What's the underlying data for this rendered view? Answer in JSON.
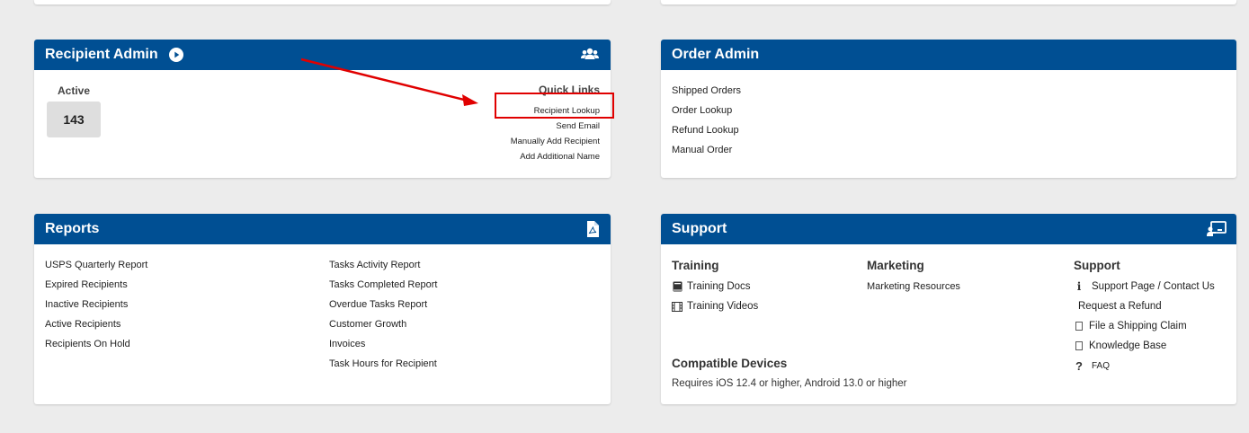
{
  "recipient_admin": {
    "title": "Recipient Admin",
    "active_label": "Active",
    "active_count": "143",
    "quick_links_title": "Quick Links",
    "quick_links": [
      "Recipient Lookup",
      "Send Email",
      "Manually Add Recipient",
      "Add Additional Name"
    ]
  },
  "order_admin": {
    "title": "Order Admin",
    "links": [
      "Shipped Orders",
      "Order Lookup",
      "Refund Lookup",
      "Manual Order"
    ]
  },
  "reports": {
    "title": "Reports",
    "left_links": [
      "USPS Quarterly Report",
      "Expired Recipients",
      "Inactive Recipients",
      "Active Recipients",
      "Recipients On Hold"
    ],
    "right_links": [
      "Tasks Activity Report",
      "Tasks Completed Report",
      "Overdue Tasks Report",
      "Customer Growth",
      "Invoices",
      "Task Hours for Recipient"
    ]
  },
  "support_card": {
    "title": "Support",
    "training": {
      "title": "Training",
      "links": [
        "Training Docs",
        "Training Videos"
      ]
    },
    "marketing": {
      "title": "Marketing",
      "links": [
        "Marketing Resources"
      ]
    },
    "support": {
      "title": "Support",
      "links": [
        "Support Page / Contact Us",
        "Request a Refund",
        "File a Shipping Claim",
        "Knowledge Base",
        "FAQ"
      ]
    },
    "compatible": {
      "title": "Compatible Devices",
      "text": "Requires iOS 12.4 or higher, Android 13.0 or higher"
    }
  },
  "colors": {
    "header": "#004f93",
    "background": "#ececec",
    "highlight": "#e00000"
  }
}
